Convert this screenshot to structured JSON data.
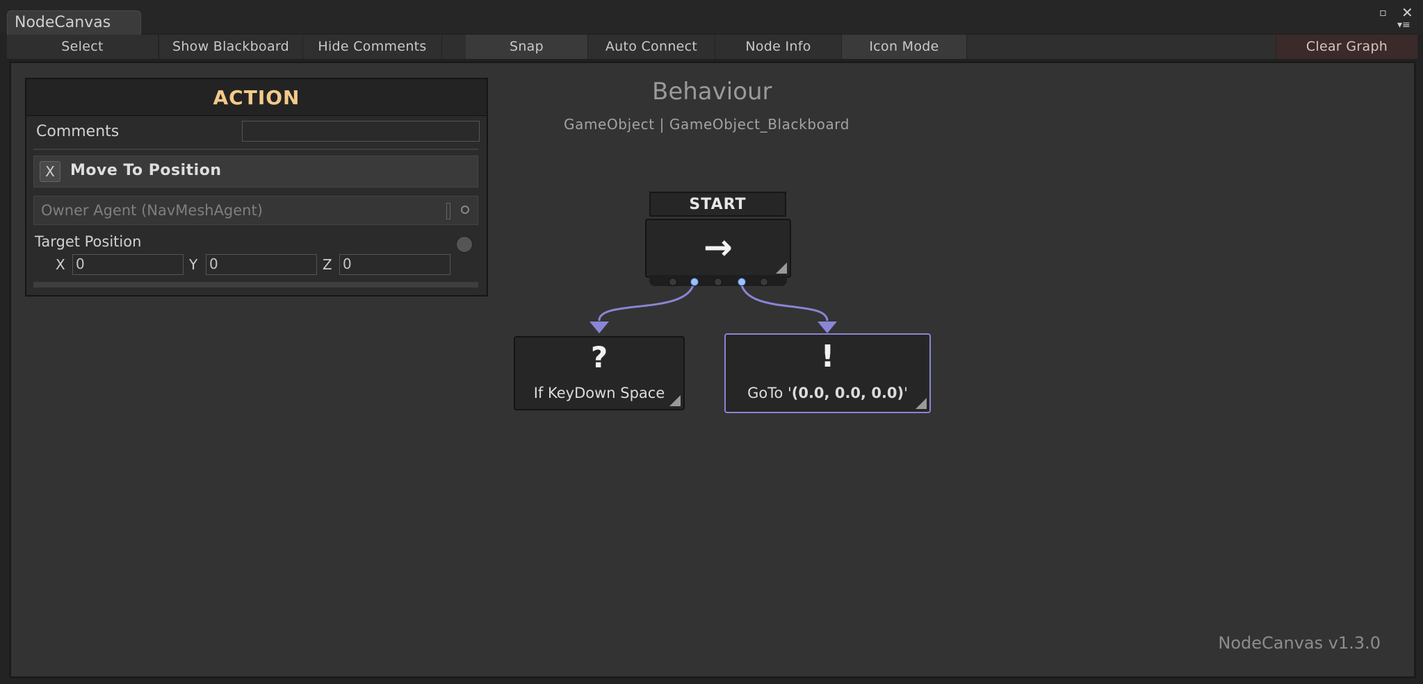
{
  "window": {
    "tab_title": "NodeCanvas",
    "icons": {
      "maximize": "maximize-icon",
      "close": "close-icon",
      "menu": "menu-icon"
    }
  },
  "toolbar": {
    "select": "Select",
    "show_blackboard": "Show Blackboard",
    "hide_comments": "Hide Comments",
    "snap": "Snap",
    "auto_connect": "Auto Connect",
    "node_info": "Node Info",
    "icon_mode": "Icon Mode",
    "clear_graph": "Clear Graph"
  },
  "graph": {
    "title": "Behaviour",
    "subtitle": "GameObject | GameObject_Blackboard",
    "version": "NodeCanvas v1.3.0"
  },
  "inspector": {
    "header": "ACTION",
    "comments_label": "Comments",
    "comments_value": "",
    "task_remove": "X",
    "task_name": "Move To Position",
    "owner_agent": "Owner Agent (NavMeshAgent)",
    "target_position_label": "Target Position",
    "x_label": "X",
    "x_value": "0",
    "y_label": "Y",
    "y_value": "0",
    "z_label": "Z",
    "z_value": "0"
  },
  "nodes": {
    "start": {
      "label": "START",
      "icon": "→"
    },
    "condition": {
      "icon": "?",
      "text": "If KeyDown Space"
    },
    "action": {
      "icon": "!",
      "text_prefix": "GoTo '",
      "text_value": "(0.0, 0.0, 0.0)",
      "text_suffix": "'"
    }
  },
  "colors": {
    "connection": "#8a85d6",
    "header_text": "#f4c98a",
    "selected_border": "#8a85d6"
  }
}
